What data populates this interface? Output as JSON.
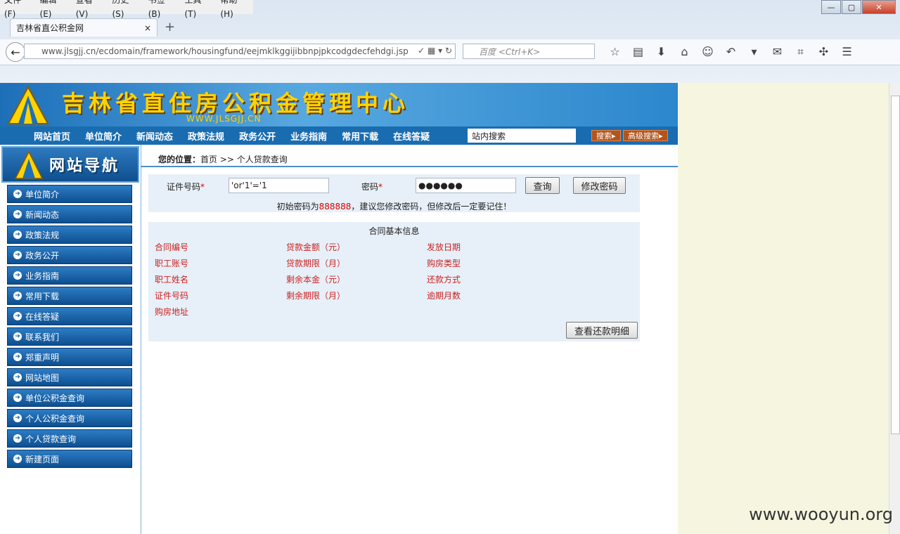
{
  "browser": {
    "menus": [
      "文件(F)",
      "编辑(E)",
      "查看(V)",
      "历史(S)",
      "书签(B)",
      "工具(T)",
      "帮助(H)"
    ],
    "tab_title": "吉林省直公积金网",
    "tab_close": "×",
    "new_tab": "+",
    "url": "www.jlsgjj.cn/ecdomain/framework/housingfund/eejmklkggijibbnpjpkcodgdecfehdgi.jsp",
    "search_placeholder": "百度 <Ctrl+K>"
  },
  "site": {
    "title": "吉林省直住房公积金管理中心",
    "domain": "WWW.JLSGJJ.CN",
    "nav": [
      "网站首页",
      "单位简介",
      "新闻动态",
      "政策法规",
      "政务公开",
      "业务指南",
      "常用下载",
      "在线答疑"
    ],
    "search_value": "站内搜索",
    "search_button": "搜索",
    "advanced_search_button": "高级搜索"
  },
  "sidebar": {
    "header": "网站导航",
    "items": [
      "单位简介",
      "新闻动态",
      "政策法规",
      "政务公开",
      "业务指南",
      "常用下载",
      "在线答疑",
      "联系我们",
      "郑重声明",
      "网站地图",
      "单位公积金查询",
      "个人公积金查询",
      "个人贷款查询",
      "新建页面"
    ]
  },
  "breadcrumb": {
    "label": "您的位置：",
    "path": "首页 >> 个人贷款查询"
  },
  "query_form": {
    "id_label": "证件号码",
    "required_mark": "*",
    "id_value": "'or'1'='1",
    "password_label": "密码",
    "password_value": "●●●●●●",
    "query_button": "查询",
    "change_password_button": "修改密码",
    "hint_prefix": "初始密码为",
    "hint_password": "888888",
    "hint_suffix": "，建议您修改密码，但修改后一定要记住！"
  },
  "contract": {
    "title": "合同基本信息",
    "fields": [
      [
        "合同编号",
        "贷款金额（元）",
        "发放日期"
      ],
      [
        "职工账号",
        "贷款期限（月）",
        "购房类型"
      ],
      [
        "职工姓名",
        "剩余本金（元）",
        "还款方式"
      ],
      [
        "证件号码",
        "剩余期限（月）",
        "逾期月数"
      ],
      [
        "购房地址",
        "",
        ""
      ]
    ],
    "detail_button": "查看还款明细"
  },
  "watermark": "www.wooyun.org"
}
